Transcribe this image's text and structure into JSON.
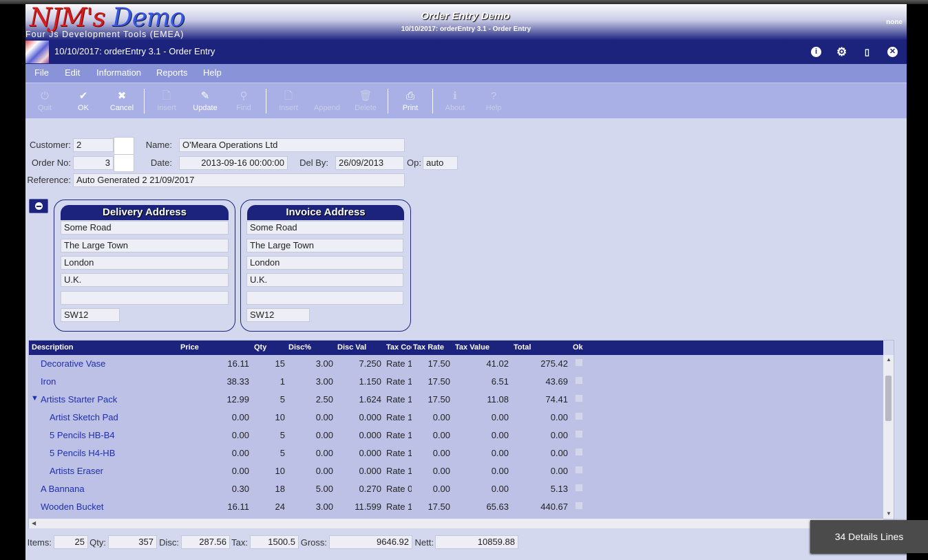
{
  "banner": {
    "logo_main": "NJM's",
    "logo_demo": "Demo",
    "logo_sub": "Four Js Development Tools (EMEA)",
    "title": "Order Entry Demo",
    "subtitle": "10/10/2017: orderEntry 3.1 - Order Entry",
    "user": "none"
  },
  "window": {
    "title": "10/10/2017: orderEntry 3.1 - Order Entry",
    "icons": [
      "info-icon",
      "settings-gear-icon",
      "bookmark-icon",
      "close-icon"
    ]
  },
  "menu": [
    "File",
    "Edit",
    "Information",
    "Reports",
    "Help"
  ],
  "toolbar": [
    {
      "label": "Quit",
      "icon": "power-icon",
      "enabled": false
    },
    {
      "label": "OK",
      "icon": "check-icon",
      "enabled": true
    },
    {
      "label": "Cancel",
      "icon": "x-icon",
      "enabled": true
    },
    {
      "label": "Insert",
      "icon": "document-icon",
      "enabled": false
    },
    {
      "label": "Update",
      "icon": "pencil-icon",
      "enabled": true
    },
    {
      "label": "Find",
      "icon": "search-icon",
      "enabled": false
    },
    {
      "label": "Insert",
      "icon": "document-icon",
      "enabled": false
    },
    {
      "label": "Append",
      "icon": "append-icon",
      "enabled": false
    },
    {
      "label": "Delete",
      "icon": "trash-icon",
      "enabled": false
    },
    {
      "label": "Print",
      "icon": "printer-icon",
      "enabled": true
    },
    {
      "label": "About",
      "icon": "info-icon",
      "enabled": false
    },
    {
      "label": "Help",
      "icon": "help-icon",
      "enabled": false
    }
  ],
  "form": {
    "customer_label": "Customer:",
    "customer": "2",
    "name_label": "Name:",
    "name": "O'Meara Operations Ltd",
    "order_label": "Order No:",
    "order_no": "3",
    "date_label": "Date:",
    "date": "2013-09-16 00:00:00",
    "delby_label": "Del By:",
    "del_by": "26/09/2013",
    "op_label": "Op:",
    "op": "auto",
    "reference_label": "Reference:",
    "reference": "Auto Generated 2 21/09/2017"
  },
  "delivery": {
    "title": "Delivery Address",
    "lines": [
      "Some Road",
      "The Large Town",
      "London",
      "U.K.",
      ""
    ],
    "postcode": "SW12"
  },
  "invoice": {
    "title": "Invoice Address",
    "lines": [
      "Some Road",
      "The Large Town",
      "London",
      "U.K.",
      ""
    ],
    "postcode": "SW12"
  },
  "grid": {
    "columns": [
      "Description",
      "Price",
      "Qty",
      "Disc%",
      "Disc Val",
      "Tax Code",
      "Tax Rate",
      "Tax Value",
      "Total",
      "Ok"
    ],
    "rows": [
      {
        "indent": 0,
        "expand": "",
        "desc": "Decorative Vase",
        "price": "16.11",
        "qty": "15",
        "discp": "3.00",
        "discv": "7.250",
        "taxcode": "Rate 1",
        "taxrate": "17.50",
        "taxval": "41.02",
        "total": "275.42"
      },
      {
        "indent": 0,
        "expand": "",
        "desc": "Iron",
        "price": "38.33",
        "qty": "1",
        "discp": "3.00",
        "discv": "1.150",
        "taxcode": "Rate 1",
        "taxrate": "17.50",
        "taxval": "6.51",
        "total": "43.69"
      },
      {
        "indent": 0,
        "expand": "▼",
        "desc": "Artists Starter Pack",
        "price": "12.99",
        "qty": "5",
        "discp": "2.50",
        "discv": "1.624",
        "taxcode": "Rate 1",
        "taxrate": "17.50",
        "taxval": "11.08",
        "total": "74.41"
      },
      {
        "indent": 1,
        "expand": "",
        "desc": "Artist Sketch Pad",
        "price": "0.00",
        "qty": "10",
        "discp": "0.00",
        "discv": "0.000",
        "taxcode": "Rate 1",
        "taxrate": "0.00",
        "taxval": "0.00",
        "total": "0.00"
      },
      {
        "indent": 1,
        "expand": "",
        "desc": "5 Pencils HB-B4",
        "price": "0.00",
        "qty": "5",
        "discp": "0.00",
        "discv": "0.000",
        "taxcode": "Rate 1",
        "taxrate": "0.00",
        "taxval": "0.00",
        "total": "0.00"
      },
      {
        "indent": 1,
        "expand": "",
        "desc": "5 Pencils H4-HB",
        "price": "0.00",
        "qty": "5",
        "discp": "0.00",
        "discv": "0.000",
        "taxcode": "Rate 1",
        "taxrate": "0.00",
        "taxval": "0.00",
        "total": "0.00"
      },
      {
        "indent": 1,
        "expand": "",
        "desc": "Artists Eraser",
        "price": "0.00",
        "qty": "10",
        "discp": "0.00",
        "discv": "0.000",
        "taxcode": "Rate 1",
        "taxrate": "0.00",
        "taxval": "0.00",
        "total": "0.00"
      },
      {
        "indent": 0,
        "expand": "",
        "desc": "A Bannana",
        "price": "0.30",
        "qty": "18",
        "discp": "5.00",
        "discv": "0.270",
        "taxcode": "Rate 0",
        "taxrate": "0.00",
        "taxval": "0.00",
        "total": "5.13"
      },
      {
        "indent": 0,
        "expand": "",
        "desc": "Wooden Bucket",
        "price": "16.11",
        "qty": "24",
        "discp": "3.00",
        "discv": "11.599",
        "taxcode": "Rate 1",
        "taxrate": "17.50",
        "taxval": "65.63",
        "total": "440.67"
      }
    ]
  },
  "totals": {
    "items_label": "Items:",
    "items": "25",
    "qty_label": "Qty:",
    "qty": "357",
    "disc_label": "Disc:",
    "disc": "287.56",
    "tax_label": "Tax:",
    "tax": "1500.5",
    "gross_label": "Gross:",
    "gross": "9646.92",
    "nett_label": "Nett:",
    "nett": "10859.88"
  },
  "toast": "34 Details Lines"
}
